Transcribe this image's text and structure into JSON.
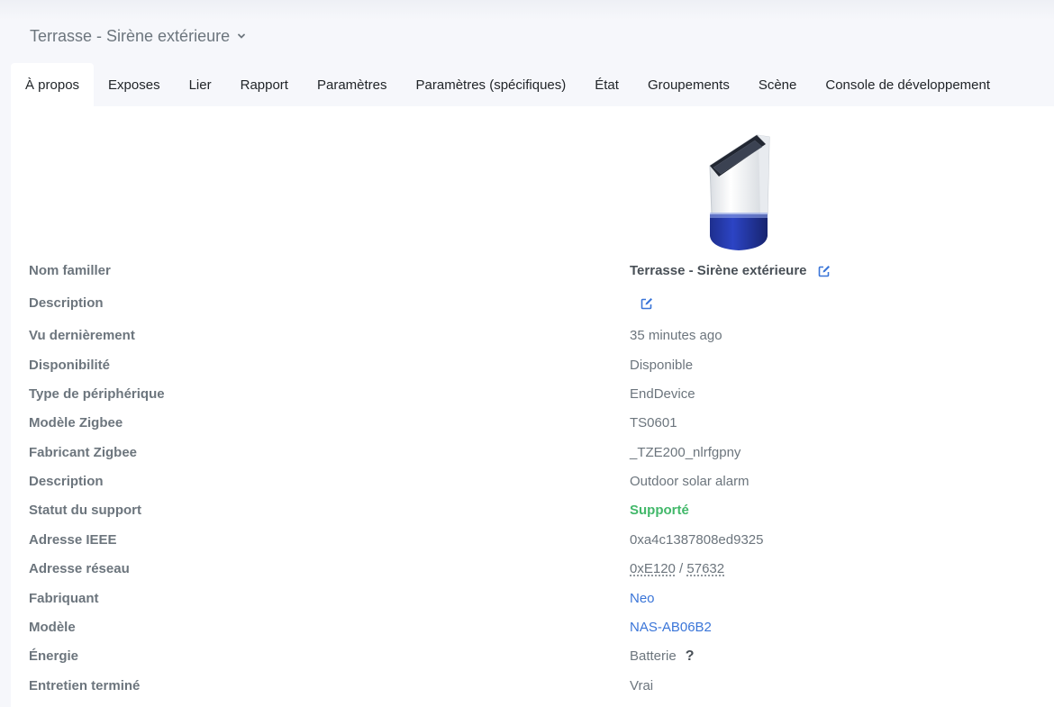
{
  "header": {
    "title": "Terrasse - Sirène extérieure"
  },
  "tabs": [
    {
      "label": "À propos"
    },
    {
      "label": "Exposes"
    },
    {
      "label": "Lier"
    },
    {
      "label": "Rapport"
    },
    {
      "label": "Paramètres"
    },
    {
      "label": "Paramètres (spécifiques)"
    },
    {
      "label": "État"
    },
    {
      "label": "Groupements"
    },
    {
      "label": "Scène"
    },
    {
      "label": "Console de développement"
    }
  ],
  "about": {
    "friendly_name": {
      "label": "Nom familler",
      "value": "Terrasse - Sirène extérieure"
    },
    "description_user": {
      "label": "Description",
      "value": ""
    },
    "last_seen": {
      "label": "Vu dernièrement",
      "value": "35 minutes ago"
    },
    "availability": {
      "label": "Disponibilité",
      "value": "Disponible"
    },
    "device_type": {
      "label": "Type de périphérique",
      "value": "EndDevice"
    },
    "zigbee_model": {
      "label": "Modèle Zigbee",
      "value": "TS0601"
    },
    "zigbee_manufacturer": {
      "label": "Fabricant Zigbee",
      "value": "_TZE200_nlrfgpny"
    },
    "description": {
      "label": "Description",
      "value": "Outdoor solar alarm"
    },
    "support_status": {
      "label": "Statut du support",
      "value": "Supporté"
    },
    "ieee_address": {
      "label": "Adresse IEEE",
      "value": "0xa4c1387808ed9325"
    },
    "network_address": {
      "label": "Adresse réseau",
      "hex": "0xE120",
      "sep": " / ",
      "dec": "57632"
    },
    "manufacturer": {
      "label": "Fabriquant",
      "value": "Neo"
    },
    "model": {
      "label": "Modèle",
      "value": "NAS-AB06B2"
    },
    "power": {
      "label": "Énergie",
      "value": "Batterie",
      "help": "?"
    },
    "interview_completed": {
      "label": "Entretien terminé",
      "value": "Vrai"
    }
  },
  "colors": {
    "accent": "#3a75d8",
    "supported": "#42b86a",
    "label": "#6c757d",
    "background": "#f6f7fb"
  }
}
